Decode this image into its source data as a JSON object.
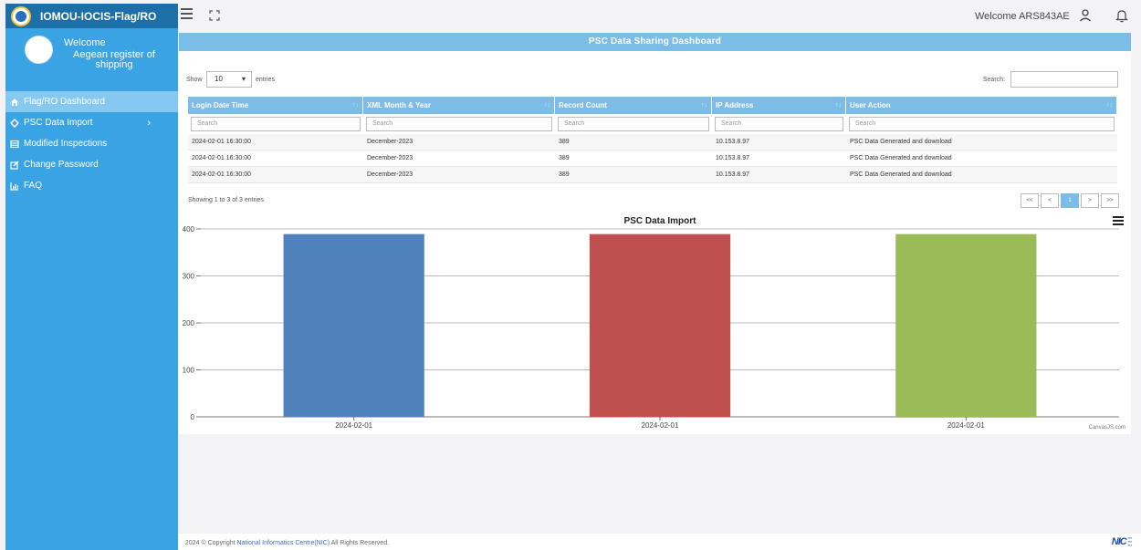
{
  "app": {
    "title": "IOMOU-IOCIS-Flag/RO"
  },
  "sidebar": {
    "welcome": "Welcome",
    "company": "Aegean register of shipping",
    "items": [
      {
        "label": "Flag/RO Dashboard",
        "icon": "home-icon",
        "active": true
      },
      {
        "label": "PSC Data Import",
        "icon": "diamond-icon",
        "has_submenu": true
      },
      {
        "label": "Modified Inspections",
        "icon": "list-icon"
      },
      {
        "label": "Change Password",
        "icon": "edit-icon"
      },
      {
        "label": "FAQ",
        "icon": "chart-icon"
      }
    ]
  },
  "topbar": {
    "welcome": "Welcome ARS843AE"
  },
  "dashboard": {
    "banner": "PSC Data Sharing Dashboard",
    "show_label": "Show",
    "entries_value": "10",
    "entries_label": "entries",
    "search_label": "Search:",
    "search_value": "",
    "columns": [
      "Login Date Time",
      "XML Month & Year",
      "Record Count",
      "IP Address",
      "User Action"
    ],
    "filter_placeholder": "Search",
    "rows": [
      [
        "2024-02-01 16:30:00",
        "December-2023",
        "389",
        "10.153.8.97",
        "PSC Data Generated and download"
      ],
      [
        "2024-02-01 16:30:00",
        "December-2023",
        "389",
        "10.153.8.97",
        "PSC Data Generated and download"
      ],
      [
        "2024-02-01 16:30:00",
        "December-2023",
        "389",
        "10.153.8.97",
        "PSC Data Generated and download"
      ]
    ],
    "info": "Showing 1 to 3 of 3 entries",
    "pager": {
      "first": "<<",
      "prev": "<",
      "current": "1",
      "next": ">",
      "last": ">>"
    }
  },
  "chart_data": {
    "type": "bar",
    "title": "PSC Data Import",
    "categories": [
      "2024-02-01",
      "2024-02-01",
      "2024-02-01"
    ],
    "values": [
      389,
      389,
      389
    ],
    "colors": [
      "#4f81bd",
      "#c0504d",
      "#9bbb59"
    ],
    "ylim": [
      0,
      400
    ],
    "yticks": [
      0,
      100,
      200,
      300,
      400
    ],
    "grid": true,
    "credit": "CanvasJS.com"
  },
  "footer": {
    "prefix": "2024 © Copyright ",
    "link": "National Informatics Centre(NIC)",
    "suffix": " All Rights Reserved.",
    "logo": "NIC"
  }
}
